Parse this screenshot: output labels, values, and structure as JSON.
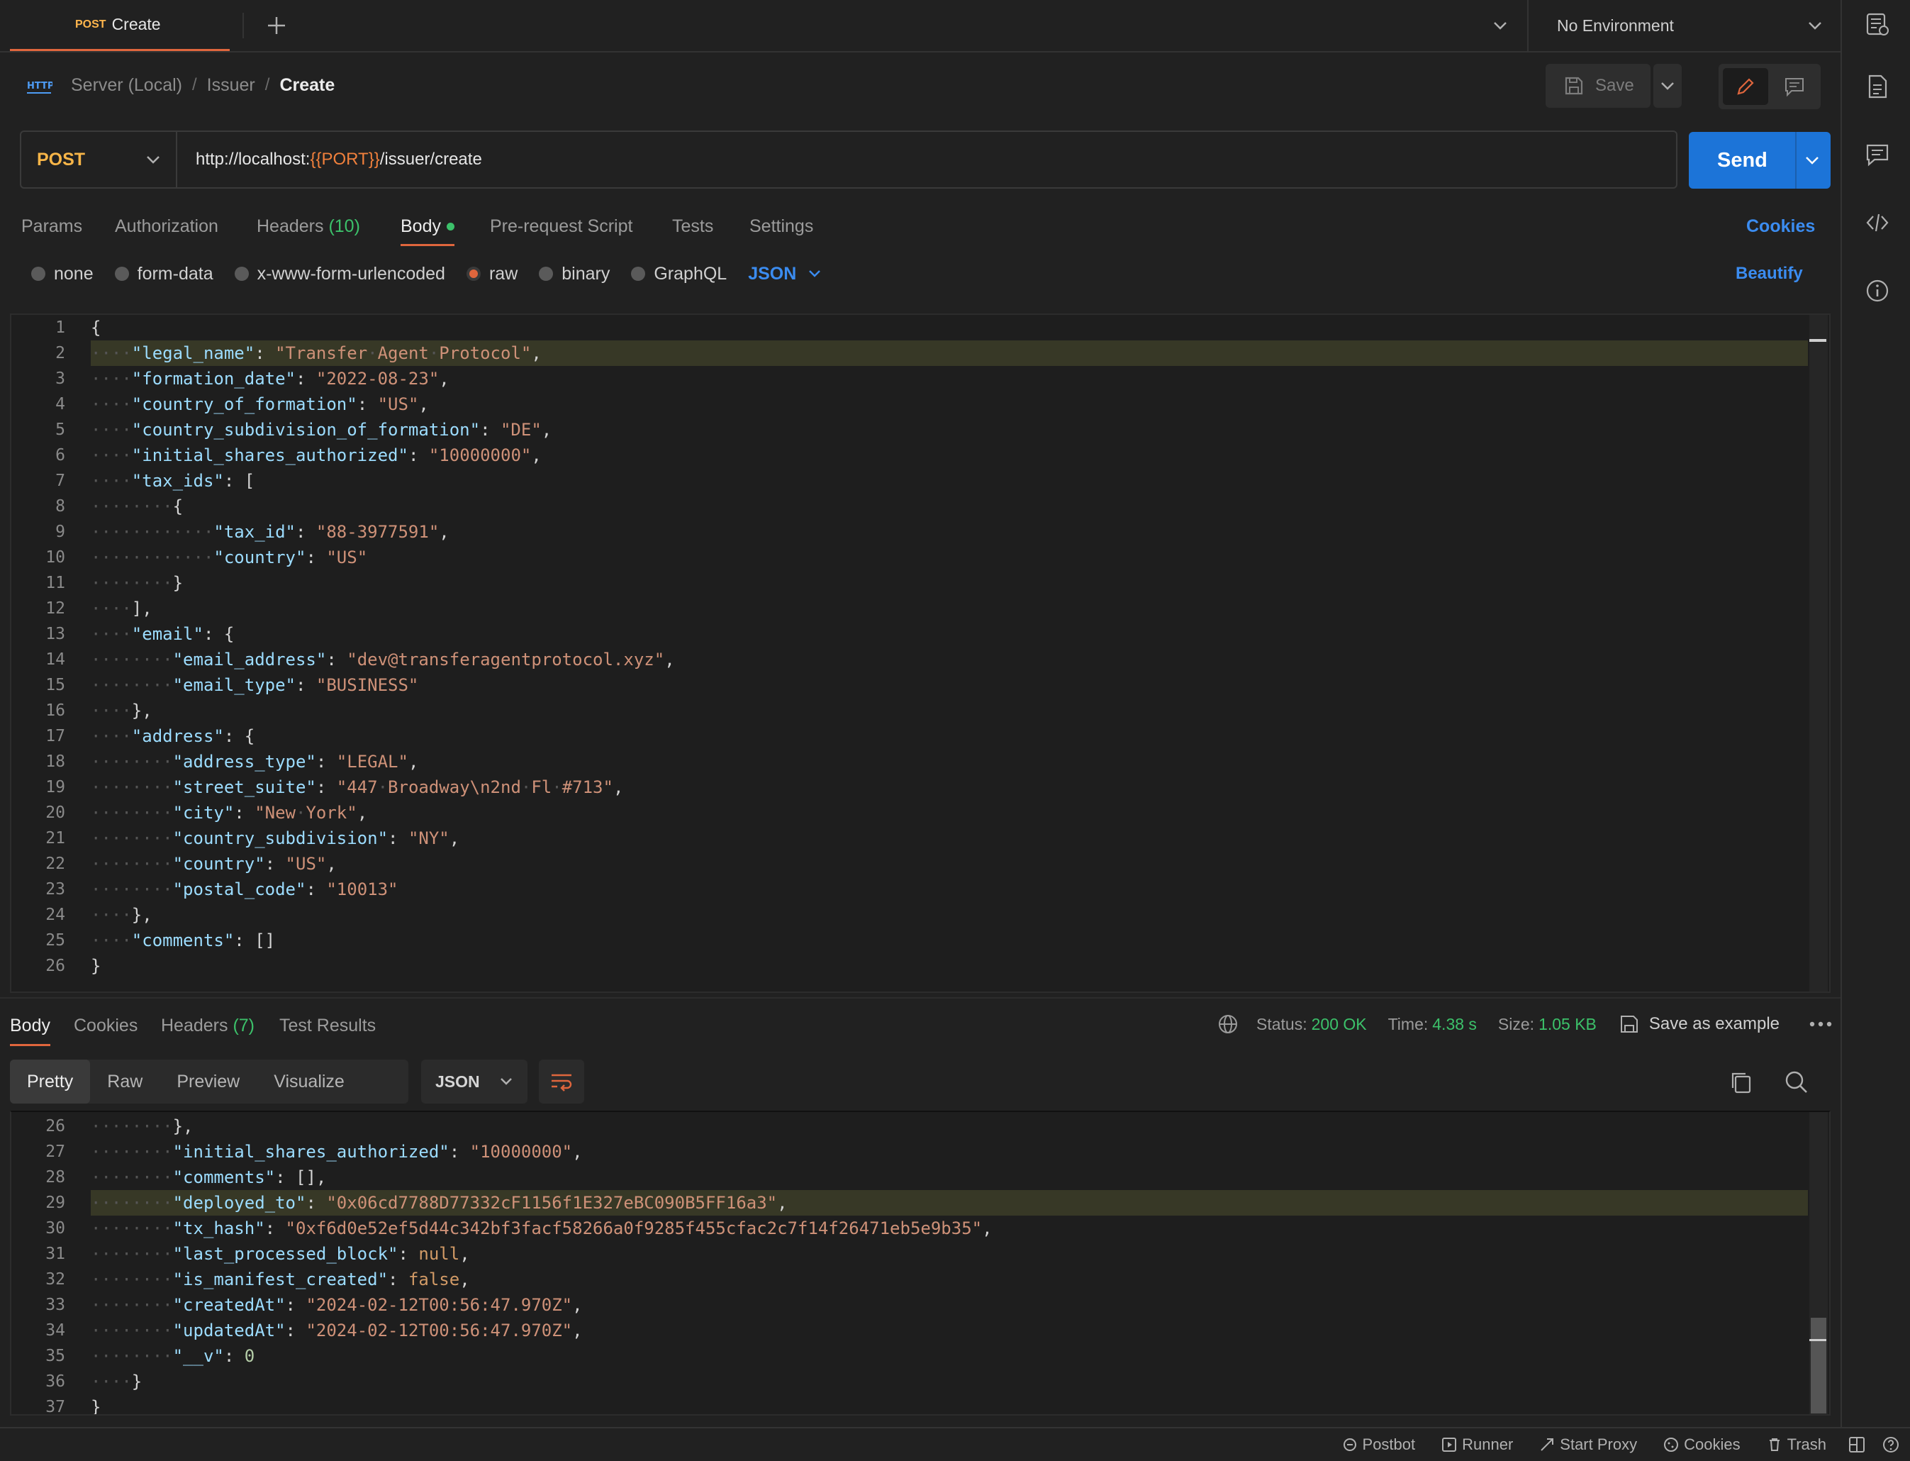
{
  "tab": {
    "method": "POST",
    "title": "Create"
  },
  "environment": {
    "selected": "No Environment"
  },
  "breadcrumb": {
    "root": "Server (Local)",
    "folder": "Issuer",
    "current": "Create"
  },
  "toolbar": {
    "save_label": "Save"
  },
  "request": {
    "method": "POST",
    "url_prefix": "http://localhost:",
    "url_var": "{{PORT}}",
    "url_suffix": "/issuer/create",
    "send_label": "Send"
  },
  "request_tabs": {
    "params": "Params",
    "authorization": "Authorization",
    "headers": "Headers",
    "headers_count": "(10)",
    "body": "Body",
    "pre_request": "Pre-request Script",
    "tests": "Tests",
    "settings": "Settings",
    "cookies": "Cookies"
  },
  "body_types": {
    "none": "none",
    "form_data": "form-data",
    "urlencoded": "x-www-form-urlencoded",
    "raw": "raw",
    "binary": "binary",
    "graphql": "GraphQL",
    "format": "JSON",
    "beautify": "Beautify"
  },
  "request_body_lines": [
    "{",
    "    \"legal_name\": \"Transfer Agent Protocol\",",
    "    \"formation_date\": \"2022-08-23\",",
    "    \"country_of_formation\": \"US\",",
    "    \"country_subdivision_of_formation\": \"DE\",",
    "    \"initial_shares_authorized\": \"10000000\",",
    "    \"tax_ids\": [",
    "        {",
    "            \"tax_id\": \"88-3977591\",",
    "            \"country\": \"US\"",
    "        }",
    "    ],",
    "    \"email\": {",
    "        \"email_address\": \"dev@transferagentprotocol.xyz\",",
    "        \"email_type\": \"BUSINESS\"",
    "    },",
    "    \"address\": {",
    "        \"address_type\": \"LEGAL\",",
    "        \"street_suite\": \"447 Broadway\\n2nd Fl #713\",",
    "        \"city\": \"New York\",",
    "        \"country_subdivision\": \"NY\",",
    "        \"country\": \"US\",",
    "        \"postal_code\": \"10013\"",
    "    },",
    "    \"comments\": []",
    "}"
  ],
  "response_tabs": {
    "body": "Body",
    "cookies": "Cookies",
    "headers": "Headers",
    "headers_count": "(7)",
    "test_results": "Test Results"
  },
  "response_status": {
    "status_label": "Status:",
    "status": "200 OK",
    "time_label": "Time:",
    "time": "4.38 s",
    "size_label": "Size:",
    "size": "1.05 KB",
    "save_example": "Save as example"
  },
  "response_view": {
    "pretty": "Pretty",
    "raw": "Raw",
    "preview": "Preview",
    "visualize": "Visualize",
    "format": "JSON"
  },
  "response_lines": [
    {
      "num": "26",
      "text": "        },"
    },
    {
      "num": "27",
      "text": "        \"initial_shares_authorized\": \"10000000\","
    },
    {
      "num": "28",
      "text": "        \"comments\": [],"
    },
    {
      "num": "29",
      "text": "        \"deployed_to\": \"0x06cd7788D77332cF1156f1E327eBC090B5FF16a3\","
    },
    {
      "num": "30",
      "text": "        \"tx_hash\": \"0xf6d0e52ef5d44c342bf3facf58266a0f9285f455cfac2c7f14f26471eb5e9b35\","
    },
    {
      "num": "31",
      "text": "        \"last_processed_block\": null,"
    },
    {
      "num": "32",
      "text": "        \"is_manifest_created\": false,"
    },
    {
      "num": "33",
      "text": "        \"createdAt\": \"2024-02-12T00:56:47.970Z\","
    },
    {
      "num": "34",
      "text": "        \"updatedAt\": \"2024-02-12T00:56:47.970Z\","
    },
    {
      "num": "35",
      "text": "        \"__v\": 0"
    },
    {
      "num": "36",
      "text": "    }"
    },
    {
      "num": "37",
      "text": "}"
    }
  ],
  "footer": {
    "postbot": "Postbot",
    "runner": "Runner",
    "proxy": "Start Proxy",
    "cookies": "Cookies",
    "trash": "Trash"
  },
  "colors": {
    "accent": "#e0663d",
    "send": "#1c74d8",
    "ok": "#3cc16a"
  }
}
